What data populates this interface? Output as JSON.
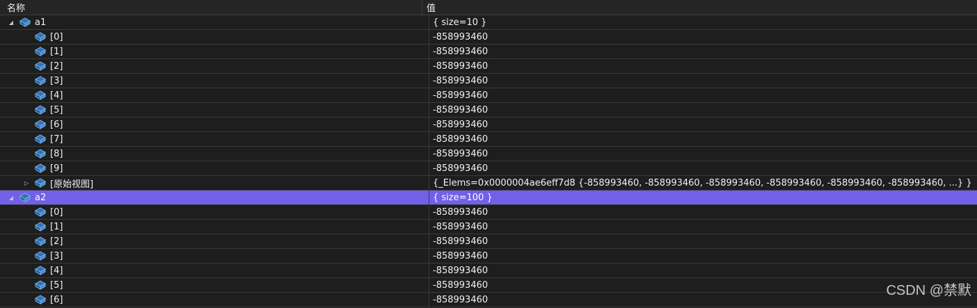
{
  "header": {
    "name_col": "名称",
    "value_col": "值"
  },
  "rows": [
    {
      "name": "a1",
      "value": "{ size=10 }",
      "level": 0,
      "expander": "expanded"
    },
    {
      "name": "[0]",
      "value": "-858993460",
      "level": 1,
      "expander": "none"
    },
    {
      "name": "[1]",
      "value": "-858993460",
      "level": 1,
      "expander": "none"
    },
    {
      "name": "[2]",
      "value": "-858993460",
      "level": 1,
      "expander": "none"
    },
    {
      "name": "[3]",
      "value": "-858993460",
      "level": 1,
      "expander": "none"
    },
    {
      "name": "[4]",
      "value": "-858993460",
      "level": 1,
      "expander": "none"
    },
    {
      "name": "[5]",
      "value": "-858993460",
      "level": 1,
      "expander": "none"
    },
    {
      "name": "[6]",
      "value": "-858993460",
      "level": 1,
      "expander": "none"
    },
    {
      "name": "[7]",
      "value": "-858993460",
      "level": 1,
      "expander": "none"
    },
    {
      "name": "[8]",
      "value": "-858993460",
      "level": 1,
      "expander": "none"
    },
    {
      "name": "[9]",
      "value": "-858993460",
      "level": 1,
      "expander": "none"
    },
    {
      "name": "[原始视图]",
      "value": "{_Elems=0x0000004ae6eff7d8 {-858993460, -858993460, -858993460, -858993460, -858993460, -858993460, ...} }",
      "level": 1,
      "expander": "collapsed"
    },
    {
      "name": "a2",
      "value": "{ size=100 }",
      "level": 0,
      "expander": "expanded",
      "selected": true
    },
    {
      "name": "[0]",
      "value": "-858993460",
      "level": 1,
      "expander": "none"
    },
    {
      "name": "[1]",
      "value": "-858993460",
      "level": 1,
      "expander": "none"
    },
    {
      "name": "[2]",
      "value": "-858993460",
      "level": 1,
      "expander": "none"
    },
    {
      "name": "[3]",
      "value": "-858993460",
      "level": 1,
      "expander": "none"
    },
    {
      "name": "[4]",
      "value": "-858993460",
      "level": 1,
      "expander": "none"
    },
    {
      "name": "[5]",
      "value": "-858993460",
      "level": 1,
      "expander": "none"
    },
    {
      "name": "[6]",
      "value": "-858993460",
      "level": 1,
      "expander": "none"
    }
  ],
  "watermark": "CSDN @禁默",
  "colors": {
    "selection": "#7160e8",
    "icon": "#5aa6e6",
    "background": "#1e1e1e"
  }
}
